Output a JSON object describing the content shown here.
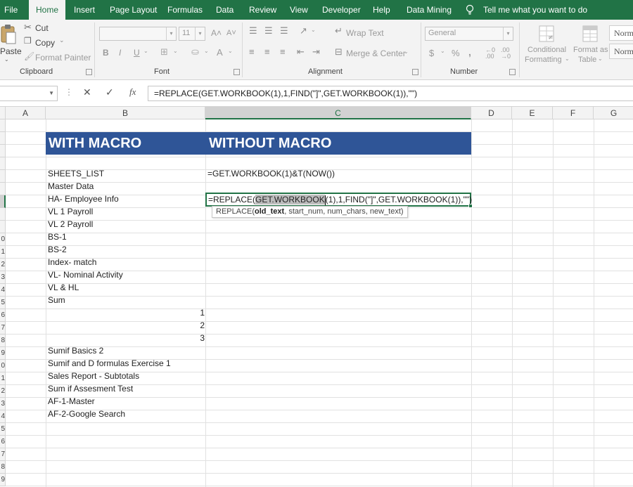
{
  "menu": {
    "tabs": [
      "File",
      "Home",
      "Insert",
      "Page Layout",
      "Formulas",
      "Data",
      "Review",
      "View",
      "Developer",
      "Help",
      "Data Mining"
    ],
    "active": "Home",
    "tell_me": "Tell me what you want to do"
  },
  "ribbon": {
    "clipboard": {
      "paste": "Paste",
      "cut": "Cut",
      "copy": "Copy",
      "format_painter": "Format Painter",
      "label": "Clipboard"
    },
    "font": {
      "size": "11",
      "label": "Font",
      "bold": "B",
      "italic": "I",
      "underline": "U"
    },
    "alignment": {
      "wrap_text": "Wrap Text",
      "merge_center": "Merge & Center",
      "label": "Alignment"
    },
    "number": {
      "format": "General",
      "currency": "$",
      "percent": "%",
      "comma": ",",
      "label": "Number"
    },
    "styles": {
      "conditional": "Conditional",
      "formatting": "Formatting",
      "format_as": "Format as",
      "table": "Table",
      "normal1": "Norm",
      "normal2": "Norm"
    }
  },
  "formula_bar": {
    "formula": "=REPLACE(GET.WORKBOOK(1),1,FIND(\"]\",GET.WORKBOOK(1)),\"\")",
    "fx": "fx"
  },
  "grid": {
    "columns": [
      "A",
      "B",
      "C",
      "D",
      "E",
      "F",
      "G"
    ],
    "selected_column": "C",
    "row_numbers": [
      "",
      "",
      "",
      "",
      "",
      "",
      "",
      "",
      "",
      "0",
      "1",
      "2",
      "3",
      "4",
      "5",
      "6",
      "7",
      "8",
      "9",
      "0",
      "1",
      "2",
      "3",
      "4",
      "5",
      "6",
      "7",
      "8",
      "9"
    ],
    "headers": {
      "with_macro": "WITH MACRO",
      "without_macro": "WITHOUT MACRO"
    },
    "c4_formula": "=GET.WORKBOOK(1)&T(NOW())",
    "sheet_list": [
      "SHEETS_LIST",
      "Master Data",
      "HA- Employee Info",
      "VL 1 Payroll",
      "VL 2 Payroll",
      "BS-1",
      "BS-2",
      "Index- match",
      "VL- Nominal Activity",
      "VL & HL",
      "Sum"
    ],
    "numbers": [
      "1",
      "2",
      "3"
    ],
    "sheet_list_2": [
      "Sumif Basics 2",
      "Sumif and D formulas Exercise 1",
      "Sales Report - Subtotals",
      "Sum if Assesment Test",
      "AF-1-Master",
      "AF-2-Google Search"
    ]
  },
  "edit": {
    "prefix": "=REPLACE(",
    "highlight": "GET.WORKBOOK",
    "after_cursor": "(1),1,FIND(\"]\",GET.WORKBOOK(1)),\"\")",
    "tooltip_fn": "REPLACE(",
    "tooltip_arg": "old_text",
    "tooltip_rest": ", start_num, num_chars, new_text)"
  }
}
